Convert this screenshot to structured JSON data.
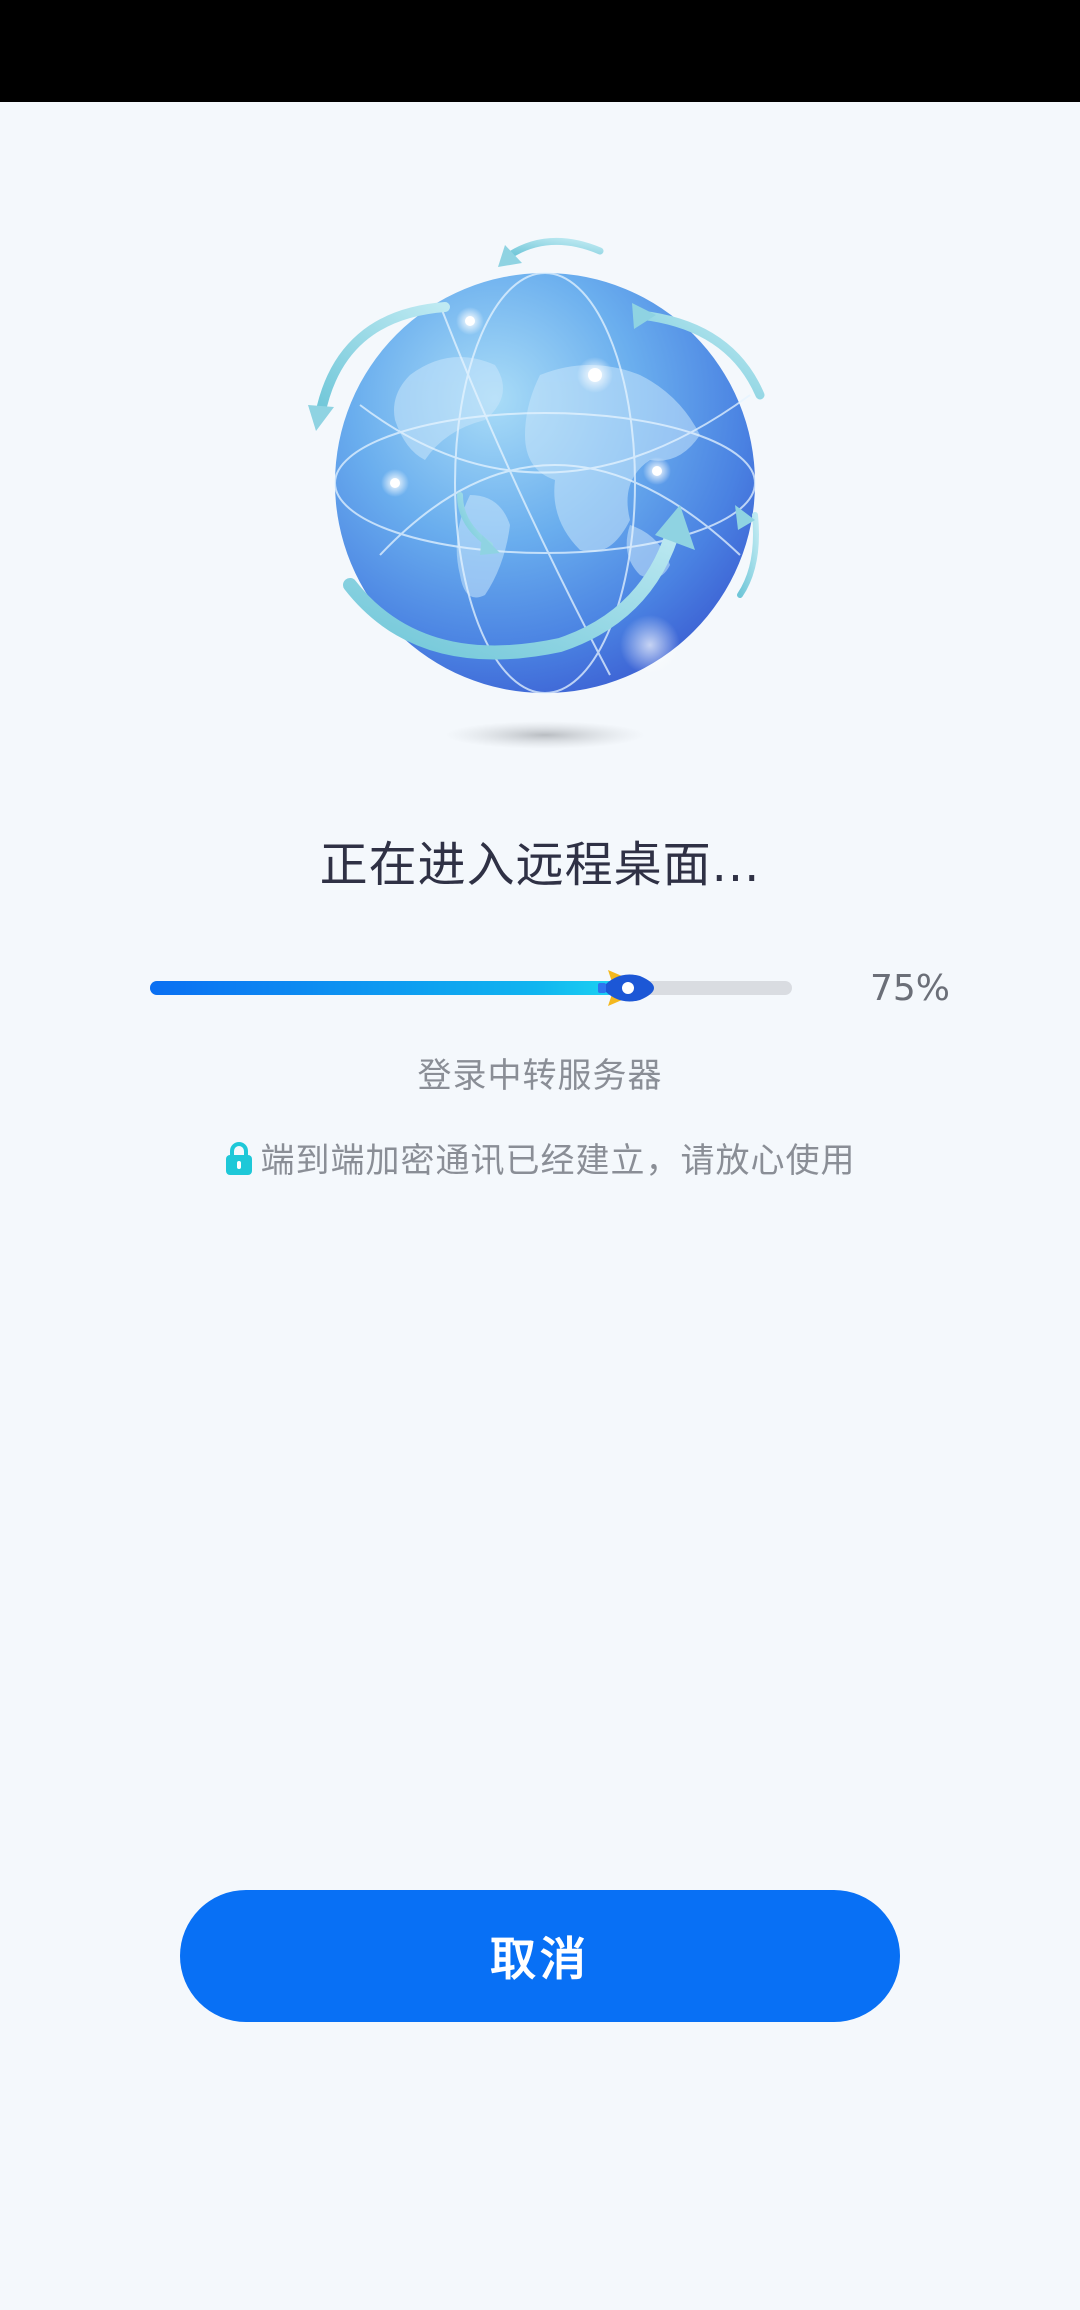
{
  "title": "正在进入远程桌面...",
  "progress": {
    "value": 0.75,
    "label": "75%"
  },
  "stage_text": "登录中转服务器",
  "secure_notice": "端到端加密通讯已经建立，请放心使用",
  "cancel_label": "取消",
  "colors": {
    "accent": "#0870f5",
    "progress_start": "#0a6ff2",
    "progress_end": "#1fd8f2",
    "lock": "#1ec8d8",
    "background": "#f4f8fc"
  },
  "icons": {
    "illustration": "globe-network-icon",
    "progress_marker": "rocket-icon",
    "secure": "lock-icon"
  }
}
